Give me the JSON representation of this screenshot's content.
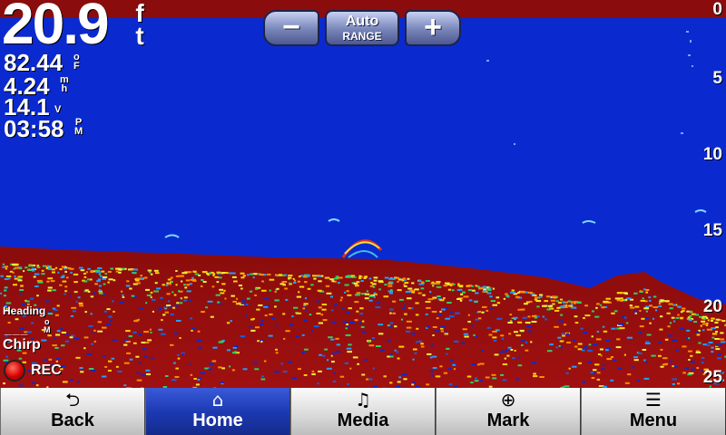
{
  "readouts": {
    "depth": "20.9",
    "depth_unit": [
      "f",
      "t"
    ],
    "water_temp": "82.44",
    "water_temp_unit": [
      "o",
      "F"
    ],
    "speed": "4.24",
    "speed_unit": [
      "m",
      "h"
    ],
    "voltage": "14.1",
    "voltage_unit": "V",
    "time": "03:58",
    "time_unit": [
      "P",
      "M"
    ]
  },
  "range": {
    "minus_icon": "minus-icon",
    "plus_icon": "plus-icon",
    "auto_label": "Auto",
    "range_label": "RANGE"
  },
  "depth_scale": [
    "0",
    "5",
    "10",
    "15",
    "20",
    "25"
  ],
  "status": {
    "heading_label": "Heading",
    "heading_value": "___",
    "heading_unit": [
      "o",
      "M"
    ],
    "frequency_label": "Chirp",
    "rec_label": "REC"
  },
  "colors": {
    "water": "#0a2ad0",
    "bottom": "#8a0c0c",
    "active_tab": "#1d3ab4",
    "rec": "#d60000"
  },
  "nav": [
    {
      "icon": "back-arrow-icon",
      "label": "Back"
    },
    {
      "icon": "home-icon",
      "label": "Home"
    },
    {
      "icon": "music-note-icon",
      "label": "Media"
    },
    {
      "icon": "crosshair-icon",
      "label": "Mark"
    },
    {
      "icon": "menu-list-icon",
      "label": "Menu"
    }
  ]
}
